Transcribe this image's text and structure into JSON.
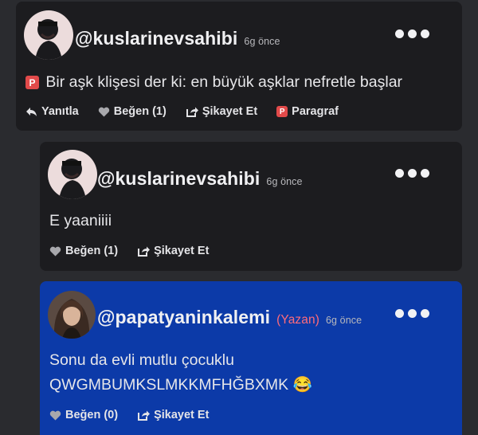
{
  "comments": [
    {
      "username": "@kuslarinevsahibi",
      "time": "6g önce",
      "badge": "P",
      "text": "Bir aşk klişesi der ki: en büyük aşklar nefretle başlar",
      "actions": {
        "reply": "Yanıtla",
        "like": "Beğen (1)",
        "report": "Şikayet Et",
        "paragraph": "Paragraf"
      }
    },
    {
      "username": "@kuslarinevsahibi",
      "time": "6g önce",
      "text": "E yaaniiii",
      "actions": {
        "like": "Beğen (1)",
        "report": "Şikayet Et"
      }
    },
    {
      "username": "@papatyaninkalemi",
      "author_tag": "(Yazan)",
      "time": "6g önce",
      "text_line1": "Sonu da evli mutlu çocuklu",
      "text_line2": "QWGMBUMKSLMKKMFHĞBXMK 😂",
      "actions": {
        "like": "Beğen (0)",
        "report": "Şikayet Et"
      }
    }
  ],
  "colors": {
    "background": "#2a2b2f",
    "card": "#1c1c1f",
    "author_card": "#0c3aa8",
    "author_tag": "#ff6b7a",
    "paragraph_badge": "#e24a4a"
  }
}
